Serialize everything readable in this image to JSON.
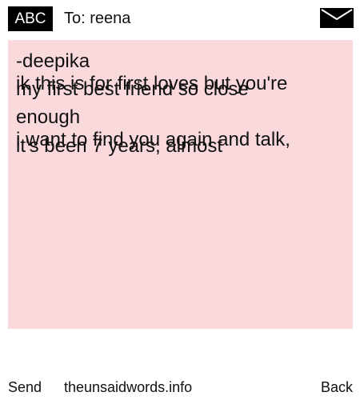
{
  "header": {
    "mode_label": "ABC",
    "to_line": "To: reena",
    "mail_icon": "envelope-icon"
  },
  "message": {
    "lines": [
      "-deepika",
      "ik this is for first loves but you're",
      "my first best friend so close",
      "enough",
      "i want to find you again and talk,",
      "it's been 7 years, almost"
    ],
    "background": "#f9d9dc"
  },
  "footer": {
    "send_label": "Send",
    "site_label": "theunsaidwords.info",
    "back_label": "Back"
  }
}
